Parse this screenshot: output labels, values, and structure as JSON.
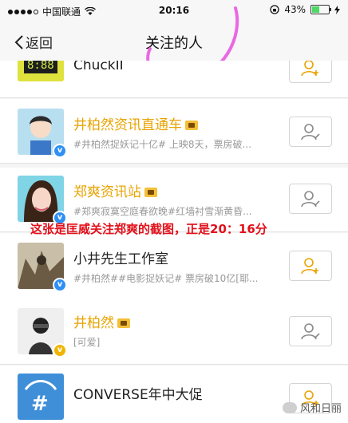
{
  "status_bar": {
    "carrier": "中国联通",
    "time": "20:16",
    "battery_percent": "43%",
    "battery_level": 0.43
  },
  "nav": {
    "back_label": "返回",
    "title": "关注的人"
  },
  "rows": [
    {
      "name": "ChuckII",
      "desc": "",
      "name_style": "normal",
      "verified": "none"
    },
    {
      "name": "井柏然资讯直通车",
      "desc": "#井柏然捉妖记十亿# 上映8天，票房破...",
      "name_style": "gold",
      "verified": "blue"
    },
    {
      "name": "郑爽资讯站",
      "desc": "#郑爽寂寞空庭春欲晚#红墙衬雪渐黄昏...",
      "name_style": "gold",
      "verified": "blue"
    },
    {
      "name": "小井先生工作室",
      "desc": "#井柏然##电影捉妖记# 票房破10亿[耶...",
      "name_style": "normal",
      "verified": "blue"
    },
    {
      "name": "井柏然",
      "desc": "[可爱]",
      "name_style": "gold",
      "verified": "gold"
    },
    {
      "name": "CONVERSE年中大促",
      "desc": "",
      "name_style": "normal",
      "verified": "none"
    }
  ],
  "annotation": "这张是匡威关注郑爽的截图，正是20：16分",
  "watermark": "风和日丽",
  "icons": {
    "signal": "signal-dots-icon",
    "wifi": "wifi-icon",
    "lock": "rotation-lock-icon",
    "charging": "charging-bolt-icon",
    "back": "chevron-left-icon",
    "follow_add": "user-plus-icon",
    "followed": "user-check-icon"
  },
  "colors": {
    "gold_name": "#e8a300",
    "annotation_red": "#e2101a",
    "verified_blue": "#2f8ff5",
    "circle_mark": "#e040e0"
  }
}
